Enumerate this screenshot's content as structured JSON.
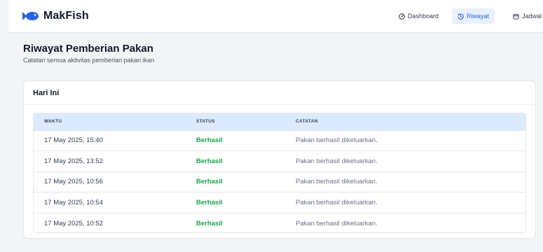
{
  "app": {
    "name": "MakFish",
    "brand_color": "#2563eb"
  },
  "nav": {
    "items": [
      {
        "label": "Dashboard",
        "icon": "dashboard-icon",
        "active": false
      },
      {
        "label": "Riwayat",
        "icon": "history-icon",
        "active": true
      },
      {
        "label": "Jadwal",
        "icon": "calendar-icon",
        "active": false
      }
    ]
  },
  "page": {
    "title": "Riwayat Pemberian Pakan",
    "subtitle": "Catatan semua aktivitas pemberian pakan ikan"
  },
  "section": {
    "title": "Hari Ini"
  },
  "table": {
    "columns": [
      "WAKTU",
      "STATUS",
      "CATATAN"
    ],
    "rows": [
      {
        "time": "17 May 2025, 15:40",
        "status": "Berhasil",
        "note": "Pakan berhasil dikeluarkan."
      },
      {
        "time": "17 May 2025, 13:52",
        "status": "Berhasil",
        "note": "Pakan berhasil dikeluarkan."
      },
      {
        "time": "17 May 2025, 10:56",
        "status": "Berhasil",
        "note": "Pakan berhasil dikeluarkan."
      },
      {
        "time": "17 May 2025, 10:54",
        "status": "Berhasil",
        "note": "Pakan berhasil dikeluarkan."
      },
      {
        "time": "17 May 2025, 10:52",
        "status": "Berhasil",
        "note": "Pakan berhasil dikeluarkan."
      }
    ],
    "status_color": "#16a34a",
    "header_bg": "#dbeafe"
  }
}
